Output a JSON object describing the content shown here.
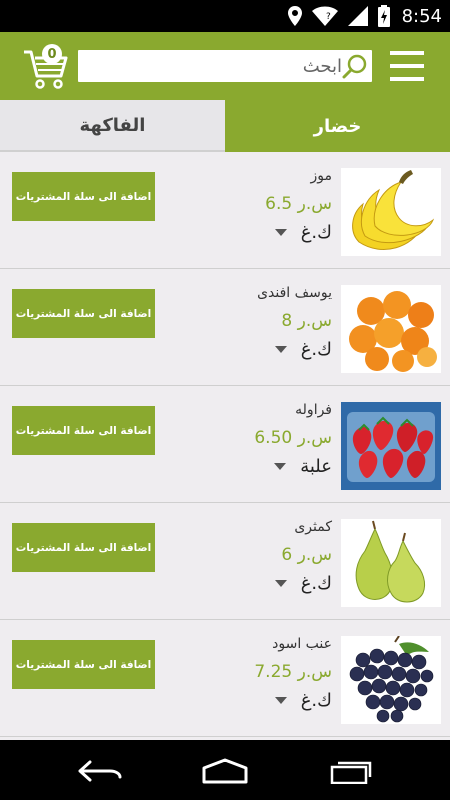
{
  "status_bar": {
    "time": "8:54"
  },
  "header": {
    "cart_count": "0",
    "search_placeholder": "ابحث"
  },
  "tabs": [
    {
      "label": "الفاكهة",
      "active": false
    },
    {
      "label": "خضار",
      "active": true
    }
  ],
  "colors": {
    "accent": "#8aa92f",
    "background": "#efedf0"
  },
  "products": [
    {
      "name": "موز",
      "price": "س.ر 6.5",
      "unit": "ك.غ",
      "add_label": "اضافة الى سلة المشتريات",
      "image": "banana"
    },
    {
      "name": "يوسف افندى",
      "price": "س.ر 8",
      "unit": "ك.غ",
      "add_label": "اضافة الى سلة المشتريات",
      "image": "tangerine"
    },
    {
      "name": "فراوله",
      "price": "س.ر 6.50",
      "unit": "علبة",
      "add_label": "اضافة الى سلة المشتريات",
      "image": "strawberry"
    },
    {
      "name": "كمثرى",
      "price": "س.ر 6",
      "unit": "ك.غ",
      "add_label": "اضافة الى سلة المشتريات",
      "image": "pear"
    },
    {
      "name": "عنب اسود",
      "price": "س.ر 7.25",
      "unit": "ك.غ",
      "add_label": "اضافة الى سلة المشتريات",
      "image": "grapes"
    }
  ]
}
